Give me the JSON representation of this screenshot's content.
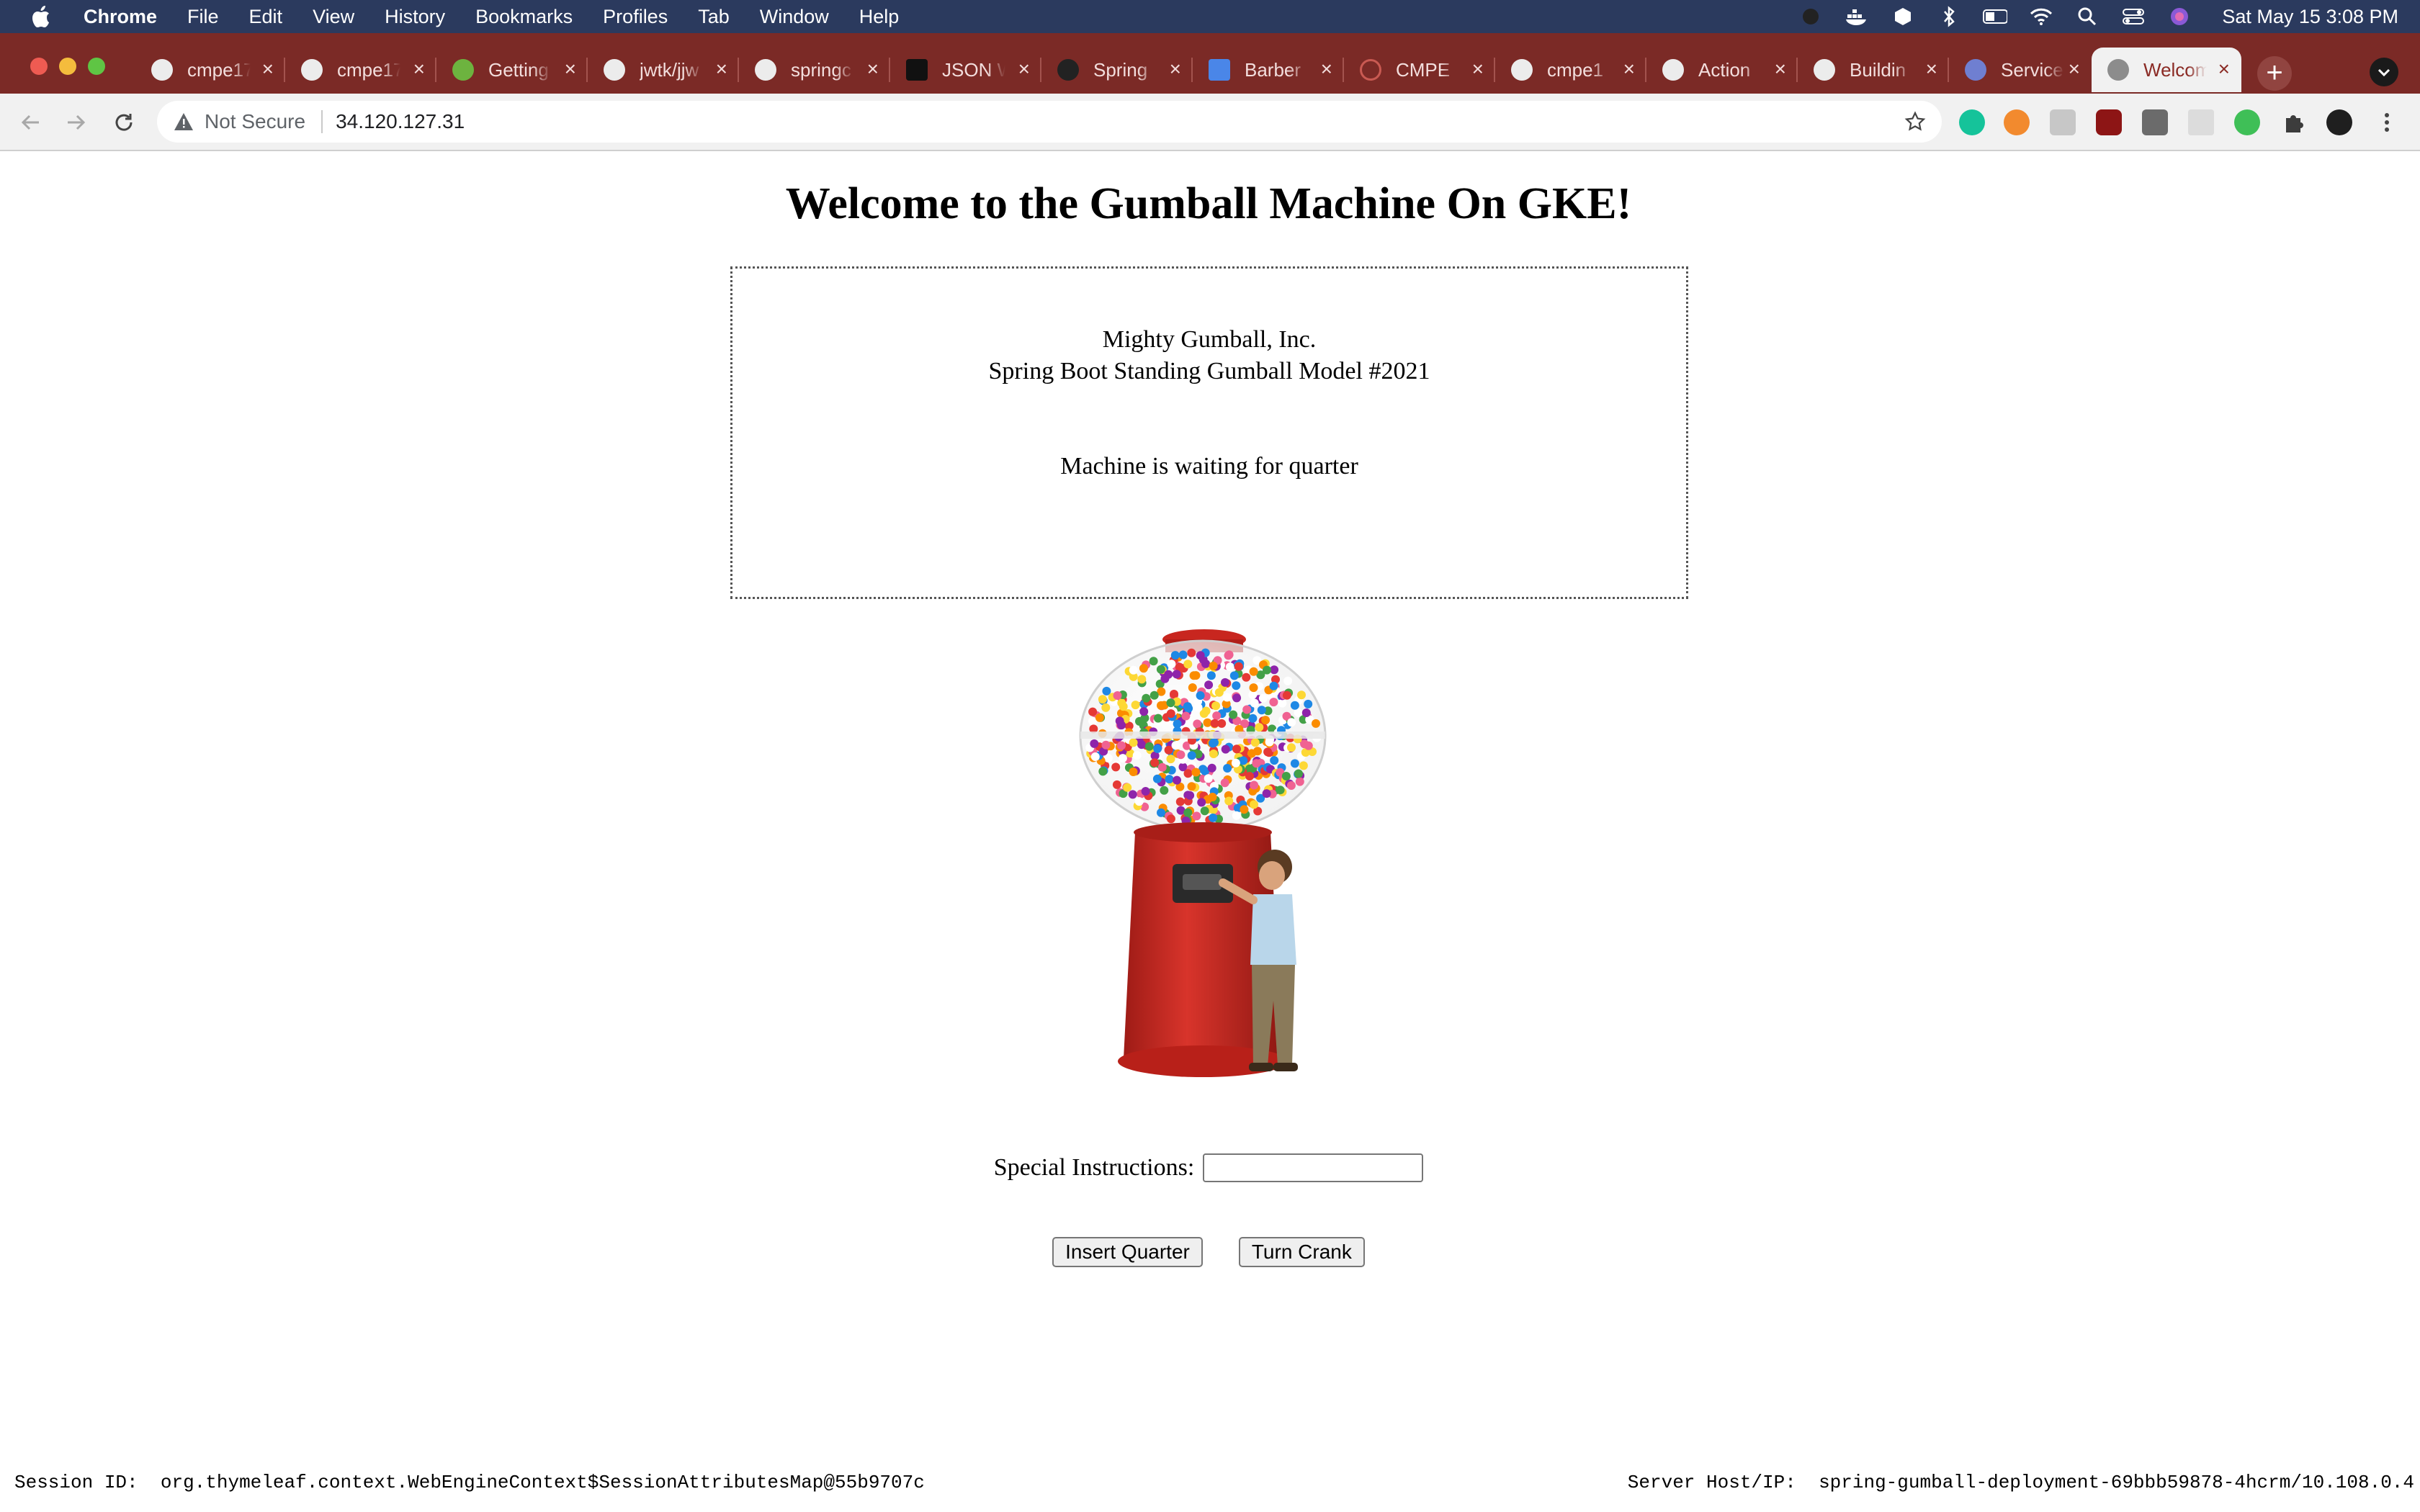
{
  "menubar": {
    "app_name": "Chrome",
    "items": [
      "File",
      "Edit",
      "View",
      "History",
      "Bookmarks",
      "Profiles",
      "Tab",
      "Window",
      "Help"
    ],
    "clock": "Sat May 15  3:08 PM"
  },
  "tabs": [
    {
      "title": "cmpe17",
      "icon": "github-icon"
    },
    {
      "title": "cmpe17",
      "icon": "github-icon"
    },
    {
      "title": "Getting",
      "icon": "spring-icon"
    },
    {
      "title": "jwtk/jjw",
      "icon": "github-icon"
    },
    {
      "title": "springc",
      "icon": "github-icon"
    },
    {
      "title": "JSON W",
      "icon": "json-icon"
    },
    {
      "title": "Spring",
      "icon": "spring-leaf-icon"
    },
    {
      "title": "Barber",
      "icon": "docs-icon"
    },
    {
      "title": "CMPE",
      "icon": "loading-icon"
    },
    {
      "title": "cmpe1",
      "icon": "github-icon"
    },
    {
      "title": "Action",
      "icon": "github-icon"
    },
    {
      "title": "Buildin",
      "icon": "github-icon"
    },
    {
      "title": "Service",
      "icon": "kubernetes-icon"
    },
    {
      "title": "Welcom",
      "icon": "globe-icon",
      "active": true
    }
  ],
  "address_bar": {
    "security_label": "Not Secure",
    "url": "34.120.127.31"
  },
  "page": {
    "heading": "Welcome to the Gumball Machine On GKE!",
    "company": "Mighty Gumball, Inc.",
    "model": "Spring Boot Standing Gumball Model #2021",
    "state": "Machine is waiting for quarter",
    "instructions_label": "Special Instructions:",
    "instructions_value": "",
    "insert_quarter_label": "Insert Quarter",
    "turn_crank_label": "Turn Crank",
    "session_label": "Session ID:",
    "session_value": "org.thymeleaf.context.WebEngineContext$SessionAttributesMap@55b9707c",
    "server_label": "Server Host/IP:",
    "server_value": "spring-gumball-deployment-69bbb59878-4hcrm/10.108.0.4"
  },
  "colors": {
    "menubar_bg": "#2b3a5e",
    "tabstrip_bg": "#7b2a26",
    "active_tab_text": "#8a2a24",
    "gumball_red": "#c8261f"
  }
}
